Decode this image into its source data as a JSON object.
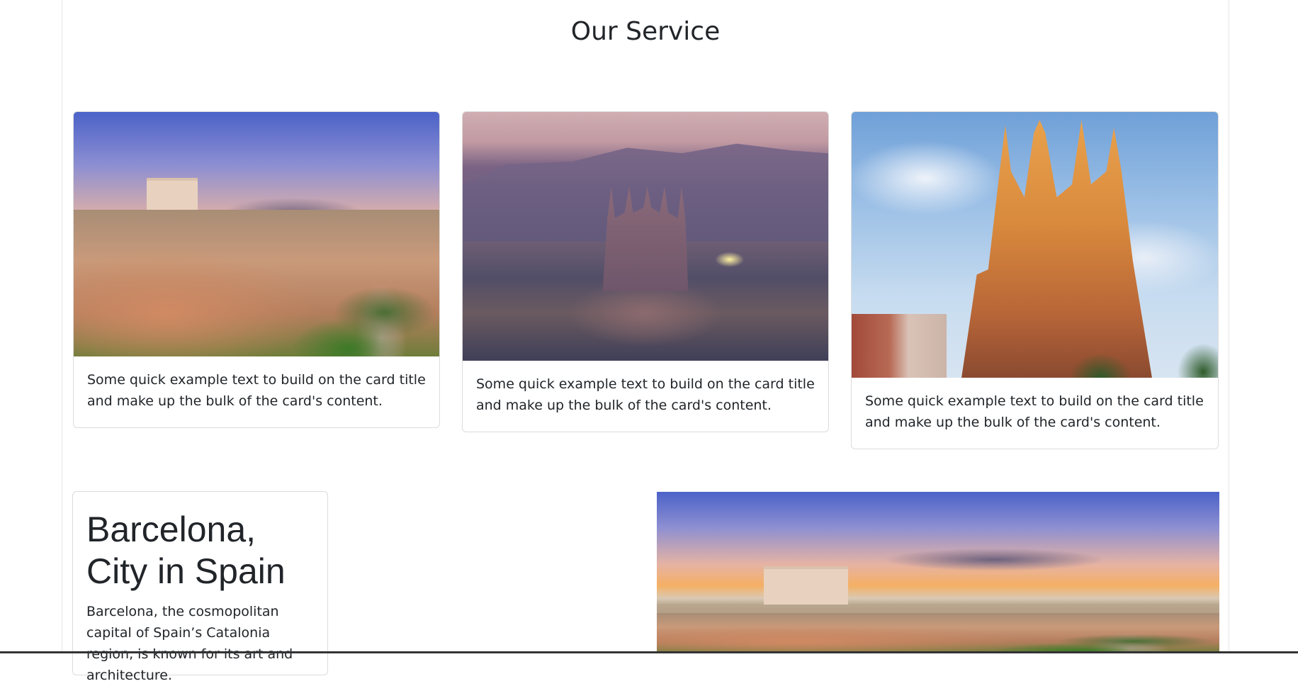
{
  "section": {
    "title": "Our Service"
  },
  "cards": [
    {
      "text": "Some quick example text to build on the card title and make up the bulk of the card's content.",
      "image": "toledo-cityscape-image"
    },
    {
      "text": "Some quick example text to build on the card title and make up the bulk of the card's content.",
      "image": "barcelona-night-image"
    },
    {
      "text": "Some quick example text to build on the card title and make up the bulk of the card's content.",
      "image": "sagrada-familia-image"
    }
  ],
  "feature": {
    "title": "Barcelona, City in Spain",
    "text": "Barcelona, the cosmopolitan capital of Spain’s Catalonia region, is known for its art and architecture."
  },
  "colors": {
    "text": "#212529",
    "border": "#dcdcdc",
    "background": "#ffffff"
  }
}
